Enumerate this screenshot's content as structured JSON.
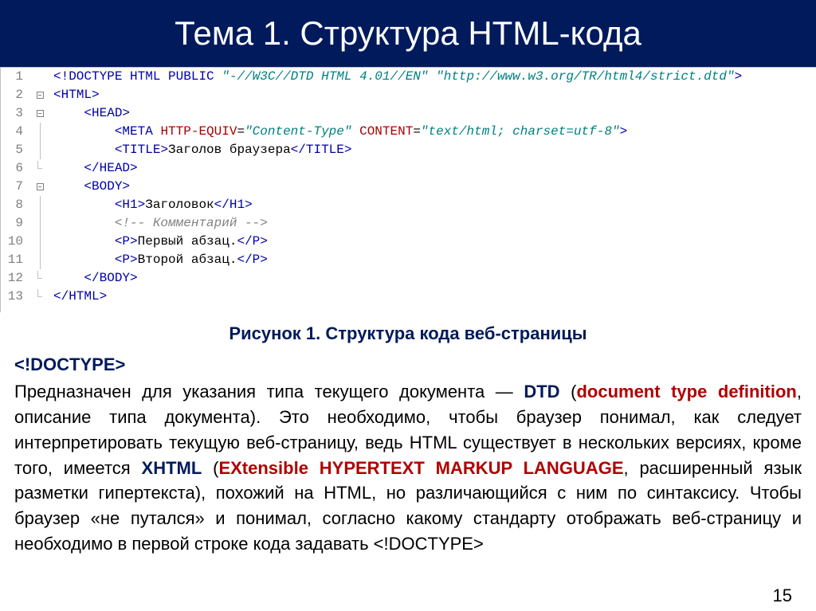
{
  "title": "Тема 1. Структура HTML-кода",
  "code": {
    "lines": [
      {
        "n": "1",
        "indent": "",
        "tokens": [
          {
            "t": "<!",
            "c": "doctype"
          },
          {
            "t": "DOCTYPE",
            "c": "doctype"
          },
          {
            "t": " ",
            "c": "plain"
          },
          {
            "t": "HTML",
            "c": "tag"
          },
          {
            "t": " ",
            "c": "plain"
          },
          {
            "t": "PUBLIC",
            "c": "tag"
          },
          {
            "t": " ",
            "c": "plain"
          },
          {
            "t": "\"-//W3C//DTD HTML 4.01//EN\"",
            "c": "quoted"
          },
          {
            "t": " ",
            "c": "plain"
          },
          {
            "t": "\"http://www.w3.org/TR/html4/strict.dtd\"",
            "c": "quoted"
          },
          {
            "t": ">",
            "c": "doctype"
          }
        ],
        "fold": "none"
      },
      {
        "n": "2",
        "indent": "",
        "tokens": [
          {
            "t": "<",
            "c": "tag"
          },
          {
            "t": "HTML",
            "c": "tag"
          },
          {
            "t": ">",
            "c": "tag"
          }
        ],
        "fold": "open"
      },
      {
        "n": "3",
        "indent": "    ",
        "tokens": [
          {
            "t": "<",
            "c": "tag"
          },
          {
            "t": "HEAD",
            "c": "tag"
          },
          {
            "t": ">",
            "c": "tag"
          }
        ],
        "fold": "open"
      },
      {
        "n": "4",
        "indent": "        ",
        "tokens": [
          {
            "t": "<",
            "c": "tag"
          },
          {
            "t": "META",
            "c": "tag"
          },
          {
            "t": " ",
            "c": "plain"
          },
          {
            "t": "HTTP-EQUIV",
            "c": "attr"
          },
          {
            "t": "=",
            "c": "plain"
          },
          {
            "t": "\"Content-Type\"",
            "c": "quoted"
          },
          {
            "t": " ",
            "c": "plain"
          },
          {
            "t": "CONTENT",
            "c": "attr"
          },
          {
            "t": "=",
            "c": "plain"
          },
          {
            "t": "\"text/html; charset=utf-8\"",
            "c": "quoted"
          },
          {
            "t": ">",
            "c": "tag"
          }
        ],
        "fold": "line"
      },
      {
        "n": "5",
        "indent": "        ",
        "tokens": [
          {
            "t": "<",
            "c": "tag"
          },
          {
            "t": "TITLE",
            "c": "tag"
          },
          {
            "t": ">",
            "c": "tag"
          },
          {
            "t": "Заголов браузера",
            "c": "plain"
          },
          {
            "t": "</",
            "c": "tag"
          },
          {
            "t": "TITLE",
            "c": "tag"
          },
          {
            "t": ">",
            "c": "tag"
          }
        ],
        "fold": "line"
      },
      {
        "n": "6",
        "indent": "    ",
        "tokens": [
          {
            "t": "</",
            "c": "tag"
          },
          {
            "t": "HEAD",
            "c": "tag"
          },
          {
            "t": ">",
            "c": "tag"
          }
        ],
        "fold": "end"
      },
      {
        "n": "7",
        "indent": "    ",
        "tokens": [
          {
            "t": "<",
            "c": "tag"
          },
          {
            "t": "BODY",
            "c": "tag"
          },
          {
            "t": ">",
            "c": "tag"
          }
        ],
        "fold": "open"
      },
      {
        "n": "8",
        "indent": "        ",
        "tokens": [
          {
            "t": "<",
            "c": "tag"
          },
          {
            "t": "H1",
            "c": "tag"
          },
          {
            "t": ">",
            "c": "tag"
          },
          {
            "t": "Заголовок",
            "c": "plain"
          },
          {
            "t": "</",
            "c": "tag"
          },
          {
            "t": "H1",
            "c": "tag"
          },
          {
            "t": ">",
            "c": "tag"
          }
        ],
        "fold": "line"
      },
      {
        "n": "9",
        "indent": "        ",
        "tokens": [
          {
            "t": "<!-- Комментарий -->",
            "c": "comment"
          }
        ],
        "fold": "line"
      },
      {
        "n": "10",
        "indent": "        ",
        "tokens": [
          {
            "t": "<",
            "c": "tag"
          },
          {
            "t": "P",
            "c": "tag"
          },
          {
            "t": ">",
            "c": "tag"
          },
          {
            "t": "Первый абзац.",
            "c": "plain"
          },
          {
            "t": "</",
            "c": "tag"
          },
          {
            "t": "P",
            "c": "tag"
          },
          {
            "t": ">",
            "c": "tag"
          }
        ],
        "fold": "line"
      },
      {
        "n": "11",
        "indent": "        ",
        "tokens": [
          {
            "t": "<",
            "c": "tag"
          },
          {
            "t": "P",
            "c": "tag"
          },
          {
            "t": ">",
            "c": "tag"
          },
          {
            "t": "Второй абзац.",
            "c": "plain"
          },
          {
            "t": "</",
            "c": "tag"
          },
          {
            "t": "P",
            "c": "tag"
          },
          {
            "t": ">",
            "c": "tag"
          }
        ],
        "fold": "line"
      },
      {
        "n": "12",
        "indent": "    ",
        "tokens": [
          {
            "t": "</",
            "c": "tag"
          },
          {
            "t": "BODY",
            "c": "tag"
          },
          {
            "t": ">",
            "c": "tag"
          }
        ],
        "fold": "end"
      },
      {
        "n": "13",
        "indent": "",
        "tokens": [
          {
            "t": "</",
            "c": "tag"
          },
          {
            "t": "HTML",
            "c": "tag"
          },
          {
            "t": ">",
            "c": "tag"
          }
        ],
        "fold": "end"
      }
    ]
  },
  "figure_caption": "Рисунок 1. Структура кода веб-страницы",
  "doctype_heading": "<!DOCTYPE>",
  "paragraph_parts": [
    {
      "t": "Предназначен для указания типа текущего документа — ",
      "c": "plain"
    },
    {
      "t": "DTD",
      "c": "kw-ru"
    },
    {
      "t": " (",
      "c": "plain"
    },
    {
      "t": "document type definition",
      "c": "kw-en"
    },
    {
      "t": ", описание типа документа). Это необходимо, чтобы браузер понимал, как следует интерпретировать текущую веб-страницу, ведь HTML существует в нескольких версиях, кроме того, имеется ",
      "c": "plain"
    },
    {
      "t": "XHTML",
      "c": "kw-ru"
    },
    {
      "t": " (",
      "c": "plain"
    },
    {
      "t": "EXtensible HYPERTEXT MARKUP LANGUAGE",
      "c": "kw-en"
    },
    {
      "t": ", расширенный язык разметки гипертекста), похожий на HTML, но различающийся с ним по синтаксису. Чтобы браузер «не путался» и понимал, согласно какому стандарту отображать веб-страницу и необходимо в первой строке кода задавать <!DOCTYPE>",
      "c": "plain"
    }
  ],
  "page_number": "15"
}
